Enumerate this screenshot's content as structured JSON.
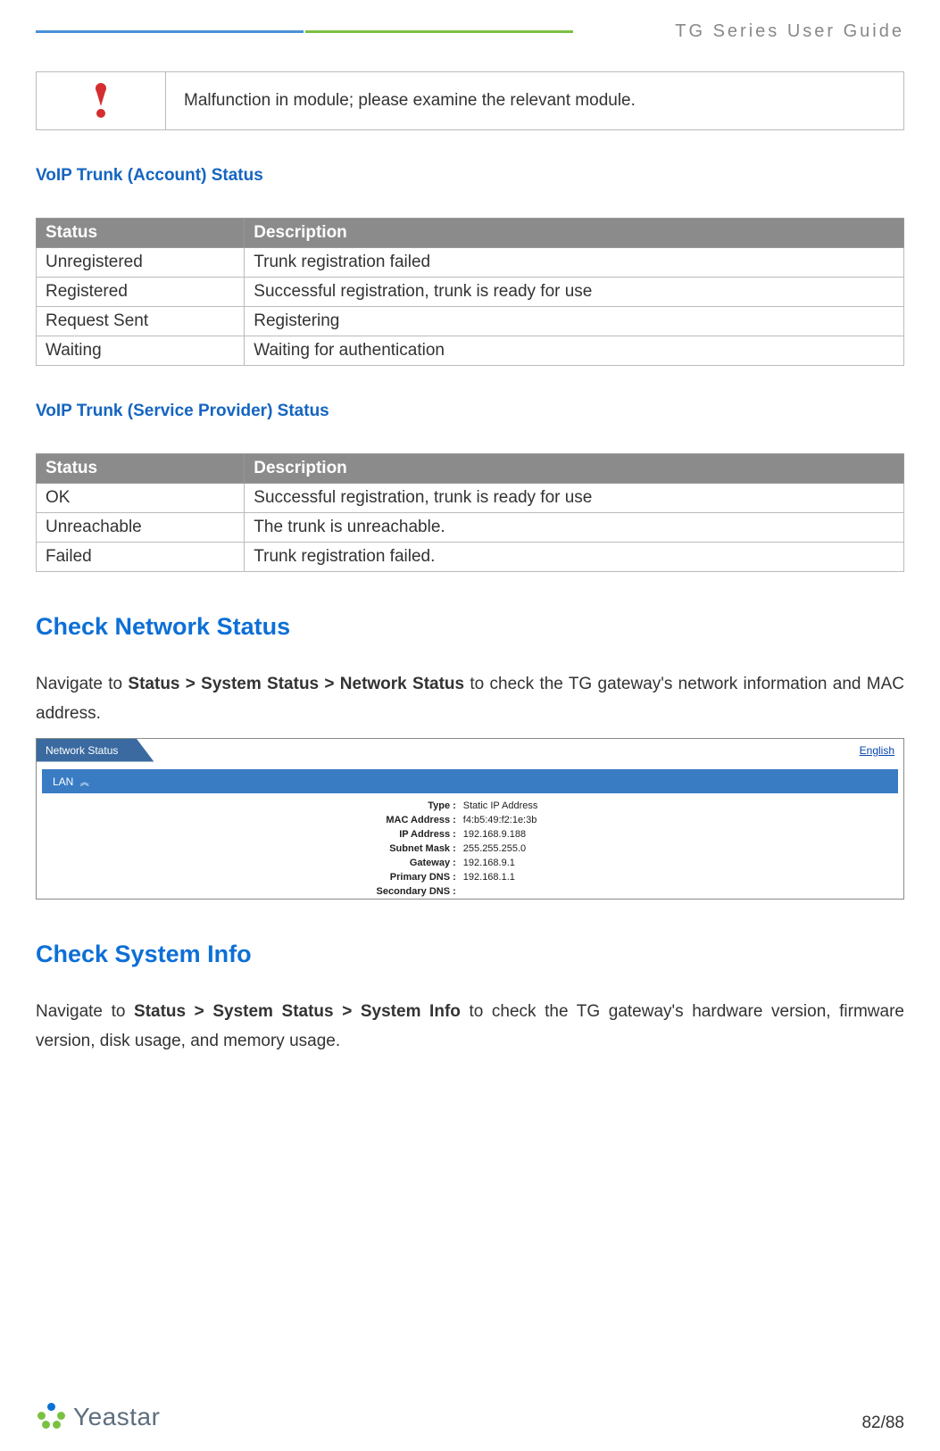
{
  "header": {
    "title": "TG  Series  User  Guide"
  },
  "malfunction": {
    "text": "Malfunction in module; please examine the relevant module."
  },
  "section_account": {
    "heading": "VoIP Trunk (Account) Status",
    "th_status": "Status",
    "th_desc": "Description",
    "rows": [
      {
        "status": "Unregistered",
        "class": "red",
        "desc": "Trunk registration failed"
      },
      {
        "status": "Registered",
        "class": "green",
        "desc": "Successful registration, trunk is ready for use"
      },
      {
        "status": "Request Sent",
        "class": "red",
        "desc": "Registering"
      },
      {
        "status": "Waiting",
        "class": "red",
        "desc": "Waiting for authentication"
      }
    ]
  },
  "section_provider": {
    "heading": "VoIP Trunk (Service Provider) Status",
    "th_status": "Status",
    "th_desc": "Description",
    "rows": [
      {
        "status": "OK",
        "class": "green",
        "desc": "Successful registration, trunk is ready for use"
      },
      {
        "status": "Unreachable",
        "class": "red",
        "desc": "The trunk is unreachable."
      },
      {
        "status": "Failed",
        "class": "red",
        "desc": "Trunk registration failed."
      }
    ]
  },
  "network": {
    "heading": "Check Network Status",
    "para_pre": "Navigate  to ",
    "para_crumb": "Status  >  System  Status  >  Network  Status",
    "para_post": "  to  check  the  TG  gateway's  network information and MAC address.",
    "ui": {
      "tab": "Network Status",
      "english": "English",
      "lan": "LAN",
      "fields": [
        {
          "label": "Type :",
          "value": "Static IP Address"
        },
        {
          "label": "MAC Address :",
          "value": "f4:b5:49:f2:1e:3b"
        },
        {
          "label": "IP Address :",
          "value": "192.168.9.188"
        },
        {
          "label": "Subnet Mask :",
          "value": "255.255.255.0"
        },
        {
          "label": "Gateway :",
          "value": "192.168.9.1"
        },
        {
          "label": "Primary DNS :",
          "value": "192.168.1.1"
        },
        {
          "label": "Secondary DNS :",
          "value": ""
        }
      ]
    }
  },
  "sysinfo": {
    "heading": "Check System Info",
    "para_pre": "Navigate to ",
    "para_crumb": "Status > System Status > System Info",
    "para_post": " to check the TG gateway's hardware version, firmware version, disk usage, and memory usage."
  },
  "footer": {
    "brand": "Yeastar",
    "pagenum": "82/88"
  }
}
